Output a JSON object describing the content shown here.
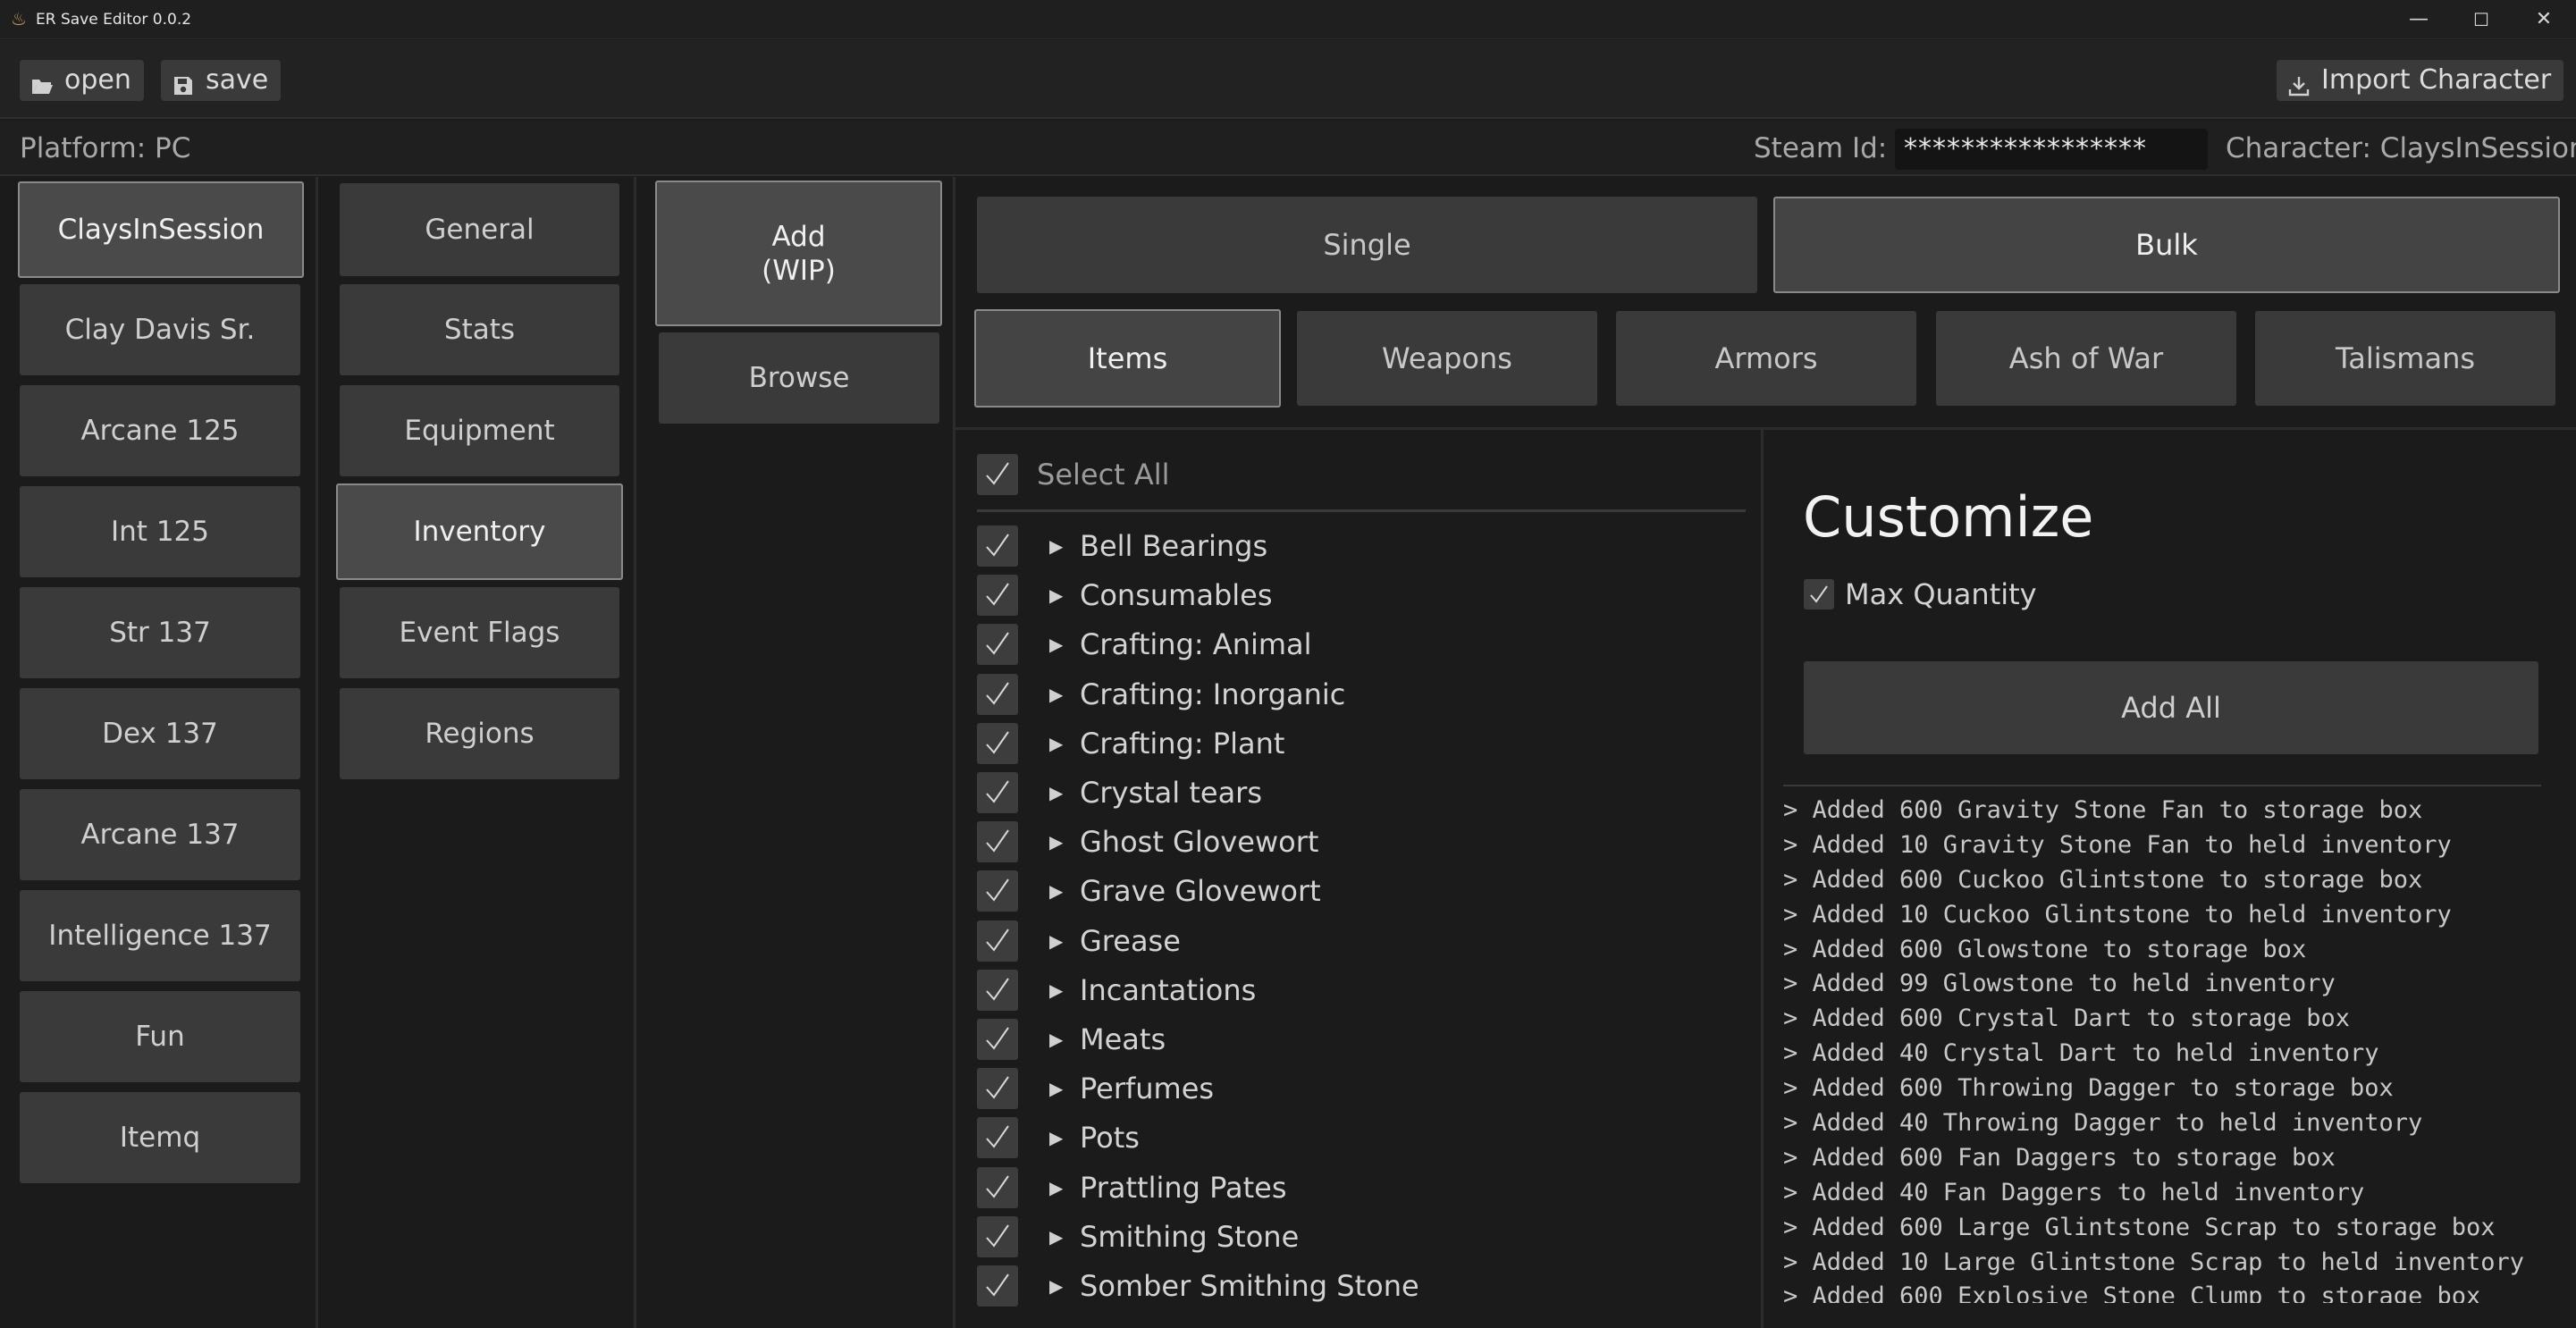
{
  "window": {
    "title": "ER Save Editor 0.0.2",
    "controls": [
      "—",
      "☐",
      "✕"
    ]
  },
  "toolbar": {
    "open_label": "open",
    "save_label": "save",
    "import_label": "Import Character"
  },
  "info": {
    "platform": "Platform: PC",
    "steam_id_label": "Steam Id:",
    "steam_id_value": "*****************",
    "character": "Character: ClaysInSession"
  },
  "characters": [
    "ClaysInSession",
    "Clay Davis Sr.",
    "Arcane 125",
    "Int 125",
    "Str 137",
    "Dex 137",
    "Arcane 137",
    "Intelligence 137",
    "Fun",
    "Itemq"
  ],
  "sections": [
    "General",
    "Stats",
    "Equipment",
    "Inventory",
    "Event Flags",
    "Regions"
  ],
  "inventory_modes": [
    "Add\n(WIP)",
    "Browse"
  ],
  "add_modes": [
    "Single",
    "Bulk"
  ],
  "categories": [
    "Items",
    "Weapons",
    "Armors",
    "Ash of War",
    "Talismans"
  ],
  "select_all_label": "Select All",
  "groups": [
    "Bell Bearings",
    "Consumables",
    "Crafting: Animal",
    "Crafting: Inorganic",
    "Crafting: Plant",
    "Crystal tears",
    "Ghost Glovewort",
    "Grave Glovewort",
    "Grease",
    "Incantations",
    "Meats",
    "Perfumes",
    "Pots",
    "Prattling Pates",
    "Smithing Stone",
    "Somber Smithing Stone"
  ],
  "customize": {
    "title": "Customize",
    "max_quantity_label": "Max Quantity",
    "add_all_label": "Add All"
  },
  "log": [
    "> Added 600 Gravity Stone Fan to storage box",
    "> Added 10 Gravity Stone Fan to held inventory",
    "> Added 600 Cuckoo Glintstone to storage box",
    "> Added 10 Cuckoo Glintstone to held inventory",
    "> Added 600 Glowstone to storage box",
    "> Added 99 Glowstone to held inventory",
    "> Added 600 Crystal Dart to storage box",
    "> Added 40 Crystal Dart to held inventory",
    "> Added 600 Throwing Dagger to storage box",
    "> Added 40 Throwing Dagger to held inventory",
    "> Added 600 Fan Daggers to storage box",
    "> Added 40 Fan Daggers to held inventory",
    "> Added 600 Large Glintstone Scrap to storage box",
    "> Added 10 Large Glintstone Scrap to held inventory",
    "> Added 600 Explosive Stone Clump to storage box"
  ],
  "colors": {
    "background": "#1b1b1b",
    "button": "#3a3a3a",
    "active_border": "#8a8a8a",
    "accent_icon": "#c9a35c"
  }
}
